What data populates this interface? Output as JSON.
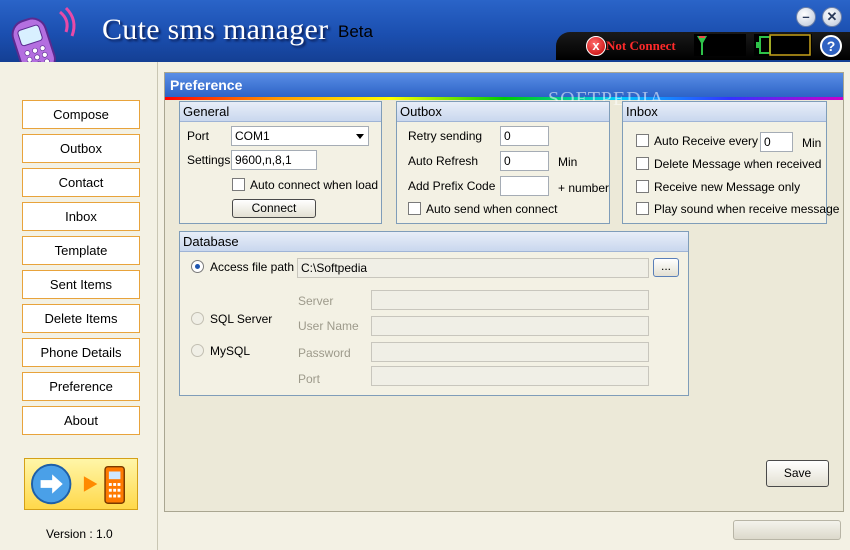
{
  "header": {
    "title": "Cute sms manager",
    "badge": "Beta",
    "status_text": "Not Connect",
    "status_icon": "x",
    "help": "?",
    "minimize": "–",
    "close": "✕"
  },
  "nav": {
    "items": [
      "Compose",
      "Outbox",
      "Contact",
      "Inbox",
      "Template",
      "Sent Items",
      "Delete Items",
      "Phone Details",
      "Preference",
      "About"
    ]
  },
  "version": "Version : 1.0",
  "preference": {
    "title": "Preference",
    "watermark": "SOFTPEDIA",
    "general": {
      "title": "General",
      "port_label": "Port",
      "port_value": "COM1",
      "settings_label": "Settings",
      "settings_value": "9600,n,8,1",
      "auto_connect_label": "Auto connect when load",
      "auto_connect_checked": false,
      "connect_button": "Connect"
    },
    "outbox": {
      "title": "Outbox",
      "retry_label": "Retry sending",
      "retry_value": "0",
      "auto_refresh_label": "Auto Refresh",
      "auto_refresh_value": "0",
      "auto_refresh_unit": "Min",
      "prefix_label": "Add Prefix Code",
      "prefix_value": "",
      "prefix_suffix": "+ number",
      "auto_send_label": "Auto send when connect",
      "auto_send_checked": false
    },
    "inbox": {
      "title": "Inbox",
      "auto_receive_label": "Auto Receive every",
      "auto_receive_value": "0",
      "auto_receive_unit": "Min",
      "delete_label": "Delete Message when received",
      "receive_new_label": "Receive new Message only",
      "play_sound_label": "Play sound when receive message"
    },
    "database": {
      "title": "Database",
      "access_label": "Access file path",
      "access_path": "C:\\Softpedia",
      "browse_button": "...",
      "sql_label": "SQL Server",
      "mysql_label": "MySQL",
      "server_label": "Server",
      "username_label": "User Name",
      "password_label": "Password",
      "port_label": "Port",
      "server_value": "",
      "username_value": "",
      "password_value": "",
      "port_value": "",
      "selected": "Access file path"
    },
    "save_button": "Save"
  },
  "colors": {
    "header_blue": "#1b4fb0",
    "nav_border": "#e8a33b",
    "status_red": "#ff2a2a",
    "panel_title_blue": "#2d63c6"
  }
}
